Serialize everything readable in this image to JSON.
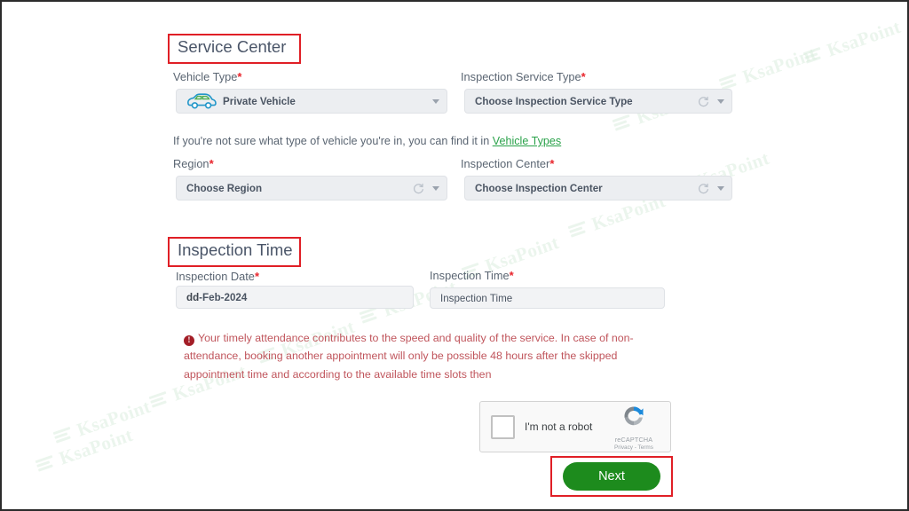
{
  "watermark": {
    "text": "KsaPoint",
    "logo_icon": "document-lines-icon",
    "color": "#d9ecdc"
  },
  "colors": {
    "highlight_box": "#e01f26",
    "heading_text": "#4a5568",
    "required_asterisk": "#e8252c",
    "link_green": "#2aa24a",
    "warning_text": "#c0555c",
    "warning_icon_bg": "#a31e27",
    "next_button_bg": "#1d8b1d",
    "field_bg": "#eceef1"
  },
  "service_center": {
    "heading": "Service Center",
    "vehicle_type": {
      "label": "Vehicle Type",
      "required": "*",
      "value": "Private Vehicle",
      "icon": "car-icon",
      "caret": "chevron-down-icon"
    },
    "inspection_service_type": {
      "label": "Inspection Service Type",
      "required": "*",
      "placeholder": "Choose Inspection Service Type",
      "refresh_icon": "refresh-spinner-icon",
      "caret": "chevron-down-icon"
    },
    "helper": {
      "prefix": "If you're not sure what type of vehicle you're in, you can find it in ",
      "link": "Vehicle Types"
    },
    "region": {
      "label": "Region",
      "required": "*",
      "placeholder": "Choose Region",
      "refresh_icon": "refresh-spinner-icon",
      "caret": "chevron-down-icon"
    },
    "inspection_center": {
      "label": "Inspection Center",
      "required": "*",
      "placeholder": "Choose Inspection Center",
      "refresh_icon": "refresh-spinner-icon",
      "caret": "chevron-down-icon"
    }
  },
  "inspection_time": {
    "heading": "Inspection Time",
    "inspection_date": {
      "label": "Inspection Date",
      "required": "*",
      "value_bold": "dd",
      "value_rest": "-Feb-2024"
    },
    "inspection_time_field": {
      "label": "Inspection Time",
      "required": "*",
      "placeholder": "Inspection Time"
    }
  },
  "warning": {
    "icon": "exclamation-circle-icon",
    "icon_glyph": "!",
    "text": "Your timely attendance contributes to the speed and quality of the service. In case of non-attendance, booking another appointment will only be possible 48 hours after the skipped appointment time and according to the available time slots then"
  },
  "recaptcha": {
    "checkbox_label": "I'm not a robot",
    "brand_name": "reCAPTCHA",
    "links": "Privacy - Terms",
    "logo_icon": "recaptcha-logo-icon"
  },
  "footer": {
    "next_label": "Next"
  }
}
